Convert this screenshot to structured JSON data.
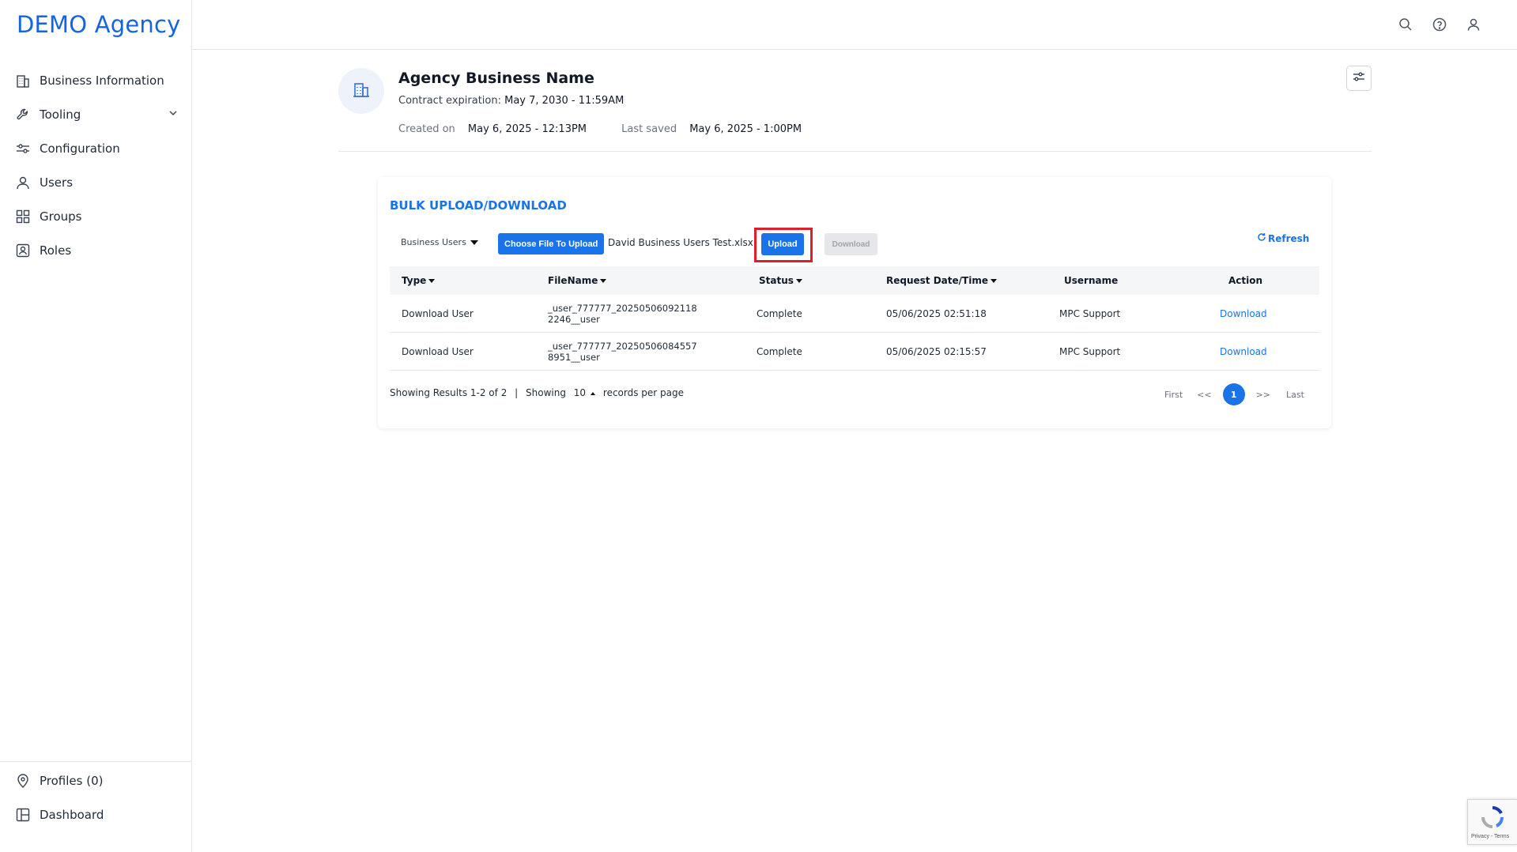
{
  "brand": "DEMO Agency",
  "sidebar": {
    "items": [
      {
        "label": "Business Information",
        "icon": "building-icon"
      },
      {
        "label": "Tooling",
        "icon": "wrench-icon"
      },
      {
        "label": "Configuration",
        "icon": "sliders-icon"
      },
      {
        "label": "Users",
        "icon": "user-icon"
      },
      {
        "label": "Groups",
        "icon": "grid-icon"
      },
      {
        "label": "Roles",
        "icon": "id-badge-icon"
      }
    ],
    "bottom_items": [
      {
        "label": "Profiles (0)",
        "icon": "location-pin-icon"
      },
      {
        "label": "Dashboard",
        "icon": "dashboard-icon"
      }
    ]
  },
  "topbar": {
    "icons": [
      "search-icon",
      "help-icon",
      "user-icon"
    ]
  },
  "header": {
    "agency_name": "Agency Business Name",
    "contract_label": "Contract expiration:",
    "contract_value": "May 7, 2030 - 11:59AM",
    "created_label": "Created on",
    "created_value": "May 6, 2025 - 12:13PM",
    "saved_label": "Last saved",
    "saved_value": "May 6, 2025 - 1:00PM"
  },
  "bulk": {
    "title": "BULK UPLOAD/DOWNLOAD",
    "type_select": "Business Users",
    "choose_label": "Choose File To Upload",
    "file_name": "David Business Users Test.xlsx",
    "upload_label": "Upload",
    "download_label": "Download",
    "refresh_label": "Refresh"
  },
  "table": {
    "headers": [
      "Type",
      "FileName",
      "Status",
      "Request Date/Time",
      "Username",
      "Action"
    ],
    "rows": [
      {
        "type": "Download User",
        "file_line1": "_user_777777_20250506092118",
        "file_line2": "2246__user",
        "status": "Complete",
        "date": "05/06/2025 02:51:18",
        "username": "MPC Support",
        "action": "Download"
      },
      {
        "type": "Download User",
        "file_line1": "_user_777777_20250506084557",
        "file_line2": "8951__user",
        "status": "Complete",
        "date": "05/06/2025 02:15:57",
        "username": "MPC Support",
        "action": "Download"
      }
    ]
  },
  "footer": {
    "showing_results": "Showing Results 1-2 of 2",
    "separator": "|",
    "showing": "Showing",
    "per_page_value": "10",
    "records_per_page": "records per page"
  },
  "pager": {
    "first": "First",
    "prev": "<<",
    "current": "1",
    "next": ">>",
    "last": "Last"
  },
  "recaptcha": {
    "text": "Privacy - Terms"
  },
  "colors": {
    "accent": "#1a73e8",
    "brand": "#1565e0",
    "highlight": "#dc1f2b"
  }
}
